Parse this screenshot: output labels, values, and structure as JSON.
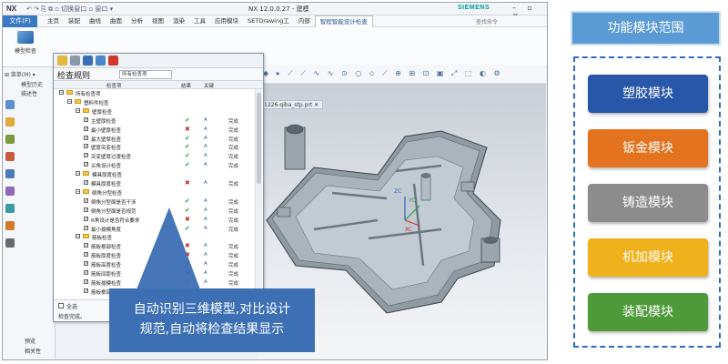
{
  "window": {
    "nx_logo": "NX",
    "quick_access": "↶ ↷ ⎘ ⧉ ▫ 切换窗口 ▫ 窗口 ▾",
    "title": "NX 12.0.0.27 - 建模",
    "brand": "SIEMENS",
    "controls": "– ▫ ✕"
  },
  "menubar": {
    "file": "文件(F)",
    "tabs": [
      "主页",
      "装配",
      "曲线",
      "曲面",
      "分析",
      "视图",
      "渲染",
      "工具",
      "应用模块",
      "SETDrawing工",
      "内部",
      "智程智能设计检查"
    ],
    "active_tab_index": 11,
    "search": "查找命令"
  },
  "ribbon": {
    "model_check_label": "模型检查"
  },
  "left_nav": {
    "header": "⊞ 菜单(M) ▾",
    "row1": "模型历史",
    "row2": "描述性",
    "preview": "预览",
    "dependency": "相关性"
  },
  "graphics": {
    "file_tab": "1226-qiba_stp.prt ✕",
    "axis_zc": "ZC",
    "axis_yc": "YC",
    "axis_xc": "XC",
    "toolbar_glyphs": "◆ ▸ ⟋ ⟋ ∿ ∿ ⊙ ○ ⬦ ⟋ ⊕ ⊞ ⊡ ▣ ⤢ ⬚ ◐ ⚙"
  },
  "dialog": {
    "title": "检查规则",
    "select_value": "所有检查项",
    "columns": {
      "item": "检查项",
      "result": "结果",
      "key": "关键"
    },
    "select_all": "全选",
    "status": "检查完成。",
    "rows": [
      {
        "level": 0,
        "type": "folder",
        "name": "所有检查项"
      },
      {
        "level": 1,
        "type": "folder",
        "name": "塑料件检查"
      },
      {
        "level": 2,
        "type": "folder",
        "name": "壁厚检查"
      },
      {
        "level": 3,
        "type": "item",
        "name": "主壁厚检查",
        "result": "✔",
        "ok": true,
        "key": "A",
        "status": "完成"
      },
      {
        "level": 3,
        "type": "item",
        "name": "最小壁厚检查",
        "result": "✖",
        "ok": false,
        "key": "A",
        "status": "完成"
      },
      {
        "level": 3,
        "type": "item",
        "name": "最大壁厚检查",
        "result": "✔",
        "ok": true,
        "key": "A",
        "status": "完成"
      },
      {
        "level": 3,
        "type": "item",
        "name": "壁厚突变检查",
        "result": "✔",
        "ok": true,
        "key": "A",
        "status": "完成"
      },
      {
        "level": 3,
        "type": "item",
        "name": "突变壁厚过渡检查",
        "result": "✔",
        "ok": true,
        "key": "A",
        "status": "完成"
      },
      {
        "level": 3,
        "type": "item",
        "name": "尖角设计检查",
        "result": "✔",
        "ok": true,
        "key": "A",
        "status": "完成"
      },
      {
        "level": 2,
        "type": "folder",
        "name": "模具厚度检查"
      },
      {
        "level": 3,
        "type": "item",
        "name": "模具厚度检查",
        "result": "✖",
        "ok": false,
        "key": "A",
        "status": "完成"
      },
      {
        "level": 2,
        "type": "folder",
        "name": "倒角分型检查"
      },
      {
        "level": 3,
        "type": "item",
        "name": "倒角分型面是否干涉",
        "result": "✔",
        "ok": true,
        "key": "A",
        "status": "完成"
      },
      {
        "level": 3,
        "type": "item",
        "name": "倒角分型面是否规范",
        "result": "✔",
        "ok": true,
        "key": "A",
        "status": "完成"
      },
      {
        "level": 3,
        "type": "item",
        "name": "R角设计是否符合要求",
        "result": "✖",
        "ok": false,
        "key": "A",
        "status": "完成"
      },
      {
        "level": 3,
        "type": "item",
        "name": "最小拔模角度",
        "result": "✔",
        "ok": true,
        "key": "A",
        "status": "完成"
      },
      {
        "level": 2,
        "type": "folder",
        "name": "筋板检查"
      },
      {
        "level": 3,
        "type": "item",
        "name": "筋板根部检查",
        "result": "✖",
        "ok": false,
        "key": "A",
        "status": "完成"
      },
      {
        "level": 3,
        "type": "item",
        "name": "筋板厚度检查",
        "result": "✖",
        "ok": false,
        "key": "A",
        "status": "完成"
      },
      {
        "level": 3,
        "type": "item",
        "name": "筋板高度检查",
        "result": "✖",
        "ok": false,
        "key": "A",
        "status": "完成"
      },
      {
        "level": 3,
        "type": "item",
        "name": "筋板间距检查",
        "result": "✖",
        "ok": false,
        "key": "A",
        "status": "完成"
      },
      {
        "level": 3,
        "type": "item",
        "name": "筋板拔模检查",
        "result": "✖",
        "ok": false,
        "key": "A",
        "status": "完成"
      },
      {
        "level": 3,
        "type": "item",
        "name": "筋板根部小圆角检查",
        "result": "✖",
        "ok": false,
        "key": "A",
        "status": "完成"
      }
    ]
  },
  "callout": {
    "line1": "自动识别三维模型,对比设计",
    "line2": "规范,自动将检查结果显示"
  },
  "func_panel": {
    "title": "功能模块范围",
    "modules": [
      {
        "label": "塑胶模块",
        "color": "#2856a8"
      },
      {
        "label": "钣金模块",
        "color": "#e3731e"
      },
      {
        "label": "铸造模块",
        "color": "#8c8c8c"
      },
      {
        "label": "机加模块",
        "color": "#f0b21c"
      },
      {
        "label": "装配模块",
        "color": "#4e9a3a"
      }
    ]
  },
  "colors": {
    "ok": "#26a03c",
    "ng": "#c8281f",
    "accent": "#3c6fb4"
  }
}
